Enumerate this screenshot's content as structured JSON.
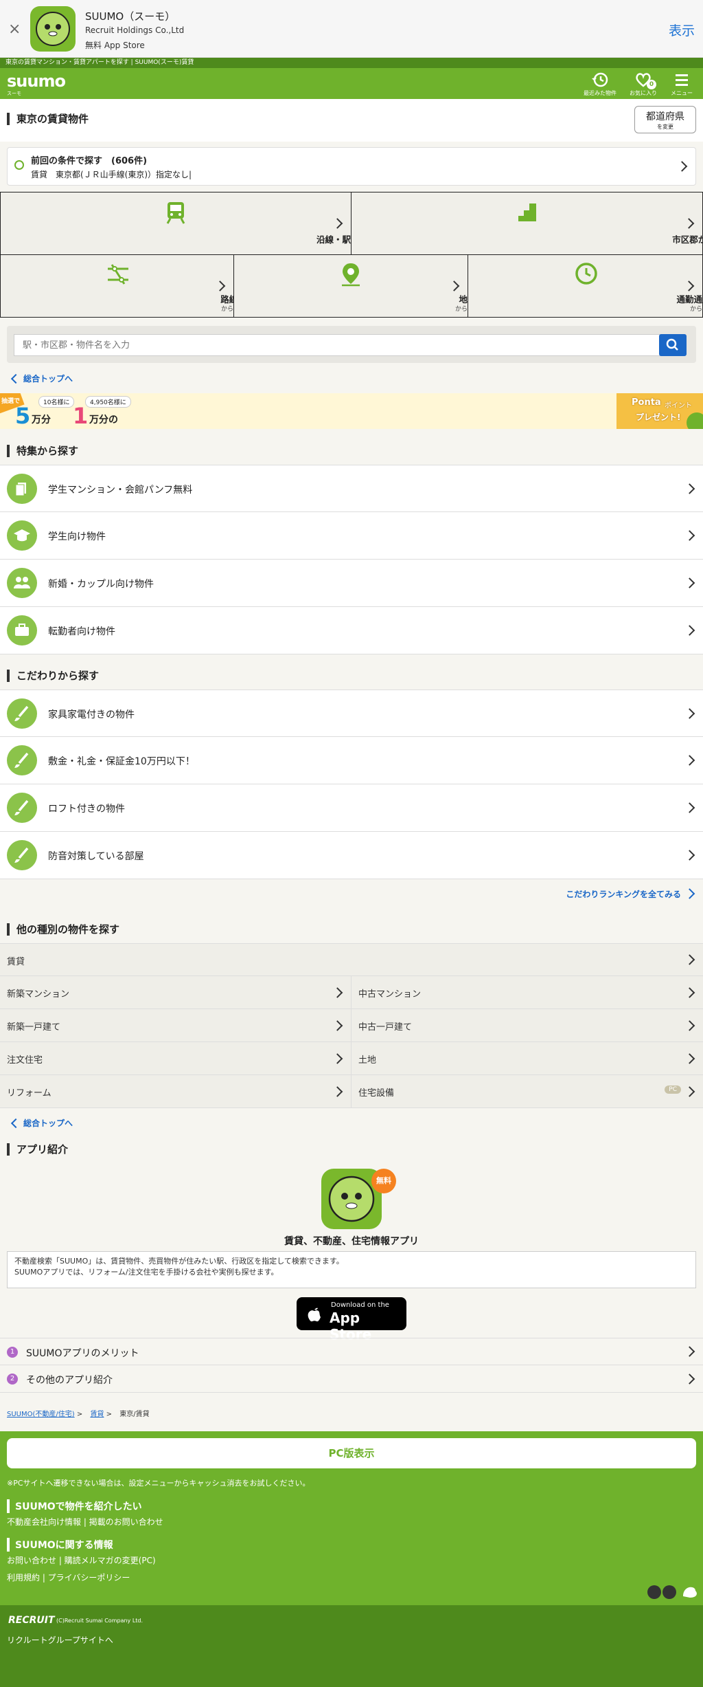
{
  "app_banner": {
    "close": "×",
    "app_name": "SUUMO（スーモ）",
    "publisher": "Recruit Holdings Co.,Ltd",
    "price_store": "無料 App Store",
    "open": "表示"
  },
  "header": {
    "breadcrumb_strip": "東京の賃貸マンション・賃貸アパートを探す | SUUMO(スーモ)賃貸",
    "logo": "suumo",
    "logo_sub": "スーモ",
    "buttons": [
      {
        "label": "最近みた物件",
        "icon": "history-icon"
      },
      {
        "label": "お気に入り",
        "icon": "heart-icon",
        "badge": "0"
      },
      {
        "label": "メニュー",
        "icon": "menu-icon"
      }
    ]
  },
  "title": {
    "heading": "東京の賃貸物件",
    "pref_button": "都道府県",
    "pref_button_sub": "を変更"
  },
  "prev_conditions": {
    "title": "前回の条件で探す　(606件)",
    "detail": "賃貸　東京都(ＪＲ山手線(東京)）指定なし|"
  },
  "search_methods": [
    {
      "label": "沿線・駅から探す",
      "sub": "",
      "icon": "train-icon"
    },
    {
      "label": "市区郡から探す",
      "sub": "",
      "icon": "area-icon"
    },
    {
      "label": "路線図",
      "sub": "から探す",
      "icon": "route-map-icon"
    },
    {
      "label": "地図",
      "sub": "から探す",
      "icon": "map-pin-icon"
    },
    {
      "label": "通勤通学時間",
      "sub": "から探す",
      "icon": "clock-icon"
    }
  ],
  "search": {
    "placeholder": "駅・市区郡・物件名を入力",
    "button_icon": "search-icon"
  },
  "back_top": "総合トップへ",
  "promo": {
    "badge": "抽選で",
    "count1": "10名様に",
    "amount1": "5",
    "unit1": "万分",
    "count2": "4,950名様に",
    "amount2": "1",
    "unit2": "万分の",
    "right1": "Ponta",
    "right1b": "ポイント",
    "right2": "プレゼント!"
  },
  "features": {
    "heading": "特集から探す",
    "items": [
      {
        "label": "学生マンション・会館パンフ無料",
        "icon": "pamphlet-icon"
      },
      {
        "label": "学生向け物件",
        "icon": "graduation-cap-icon"
      },
      {
        "label": "新婚・カップル向け物件",
        "icon": "couple-icon"
      },
      {
        "label": "転勤者向け物件",
        "icon": "briefcase-icon"
      }
    ]
  },
  "kodawari": {
    "heading": "こだわりから探す",
    "items": [
      {
        "label": "家具家電付きの物件",
        "icon": "brush-icon"
      },
      {
        "label": "敷金・礼金・保証金10万円以下！",
        "icon": "brush-icon"
      },
      {
        "label": "ロフト付きの物件",
        "icon": "brush-icon"
      },
      {
        "label": "防音対策している部屋",
        "icon": "brush-icon"
      }
    ],
    "ranking_link": "こだわりランキングを全てみる"
  },
  "other_types": {
    "heading": "他の種別の物件を探す",
    "full_row": "賃貸",
    "grid": [
      [
        "新築マンション",
        "中古マンション"
      ],
      [
        "新築一戸建て",
        "中古一戸建て"
      ],
      [
        "注文住宅",
        "土地"
      ],
      [
        "リフォーム",
        "住宅設備"
      ]
    ],
    "pc_badge": "PC"
  },
  "app_intro": {
    "heading": "アプリ紹介",
    "free_badge": "無料",
    "title": "賃貸、不動産、住宅情報アプリ",
    "desc1": "不動産検索「SUUMO」は、賃貸物件、売買物件が住みたい駅、行政区を指定して検索できます。",
    "desc2": "SUUMOアプリでは、リフォーム/注文住宅を手掛ける会社や実例も探せます。",
    "store_small": "Download on the",
    "store_big": "App Store",
    "links": [
      {
        "num": "1",
        "label": "SUUMOアプリのメリット"
      },
      {
        "num": "2",
        "label": "その他のアプリ紹介"
      }
    ]
  },
  "breadcrumb": {
    "home": "SUUMO(不動産/住宅)",
    "mid": "賃貸",
    "current": "東京/賃貸",
    "sep": ">"
  },
  "footer": {
    "pc_view": "PC版表示",
    "note": "※PCサイトへ遷移できない場合は、設定メニューからキャッシュ消去をお試しください。",
    "sec1_title": "SUUMOで物件を紹介したい",
    "sec1_links": "不動産会社向け情報 | 掲載のお問い合わせ",
    "sec2_title": "SUUMOに関する情報",
    "sec2_links1": "お問い合わせ | 購読メルマガの変更(PC)",
    "sec2_links2": "利用規約 | プライバシーポリシー"
  },
  "copyright": {
    "logo": "RECRUIT",
    "text": "(C)Recruit Sumai Company Ltd.",
    "group": "リクルートグループサイトへ"
  },
  "colors": {
    "brand_green": "#6fb22c",
    "dark_green": "#4e8a1c",
    "link_blue": "#1a67c7"
  }
}
